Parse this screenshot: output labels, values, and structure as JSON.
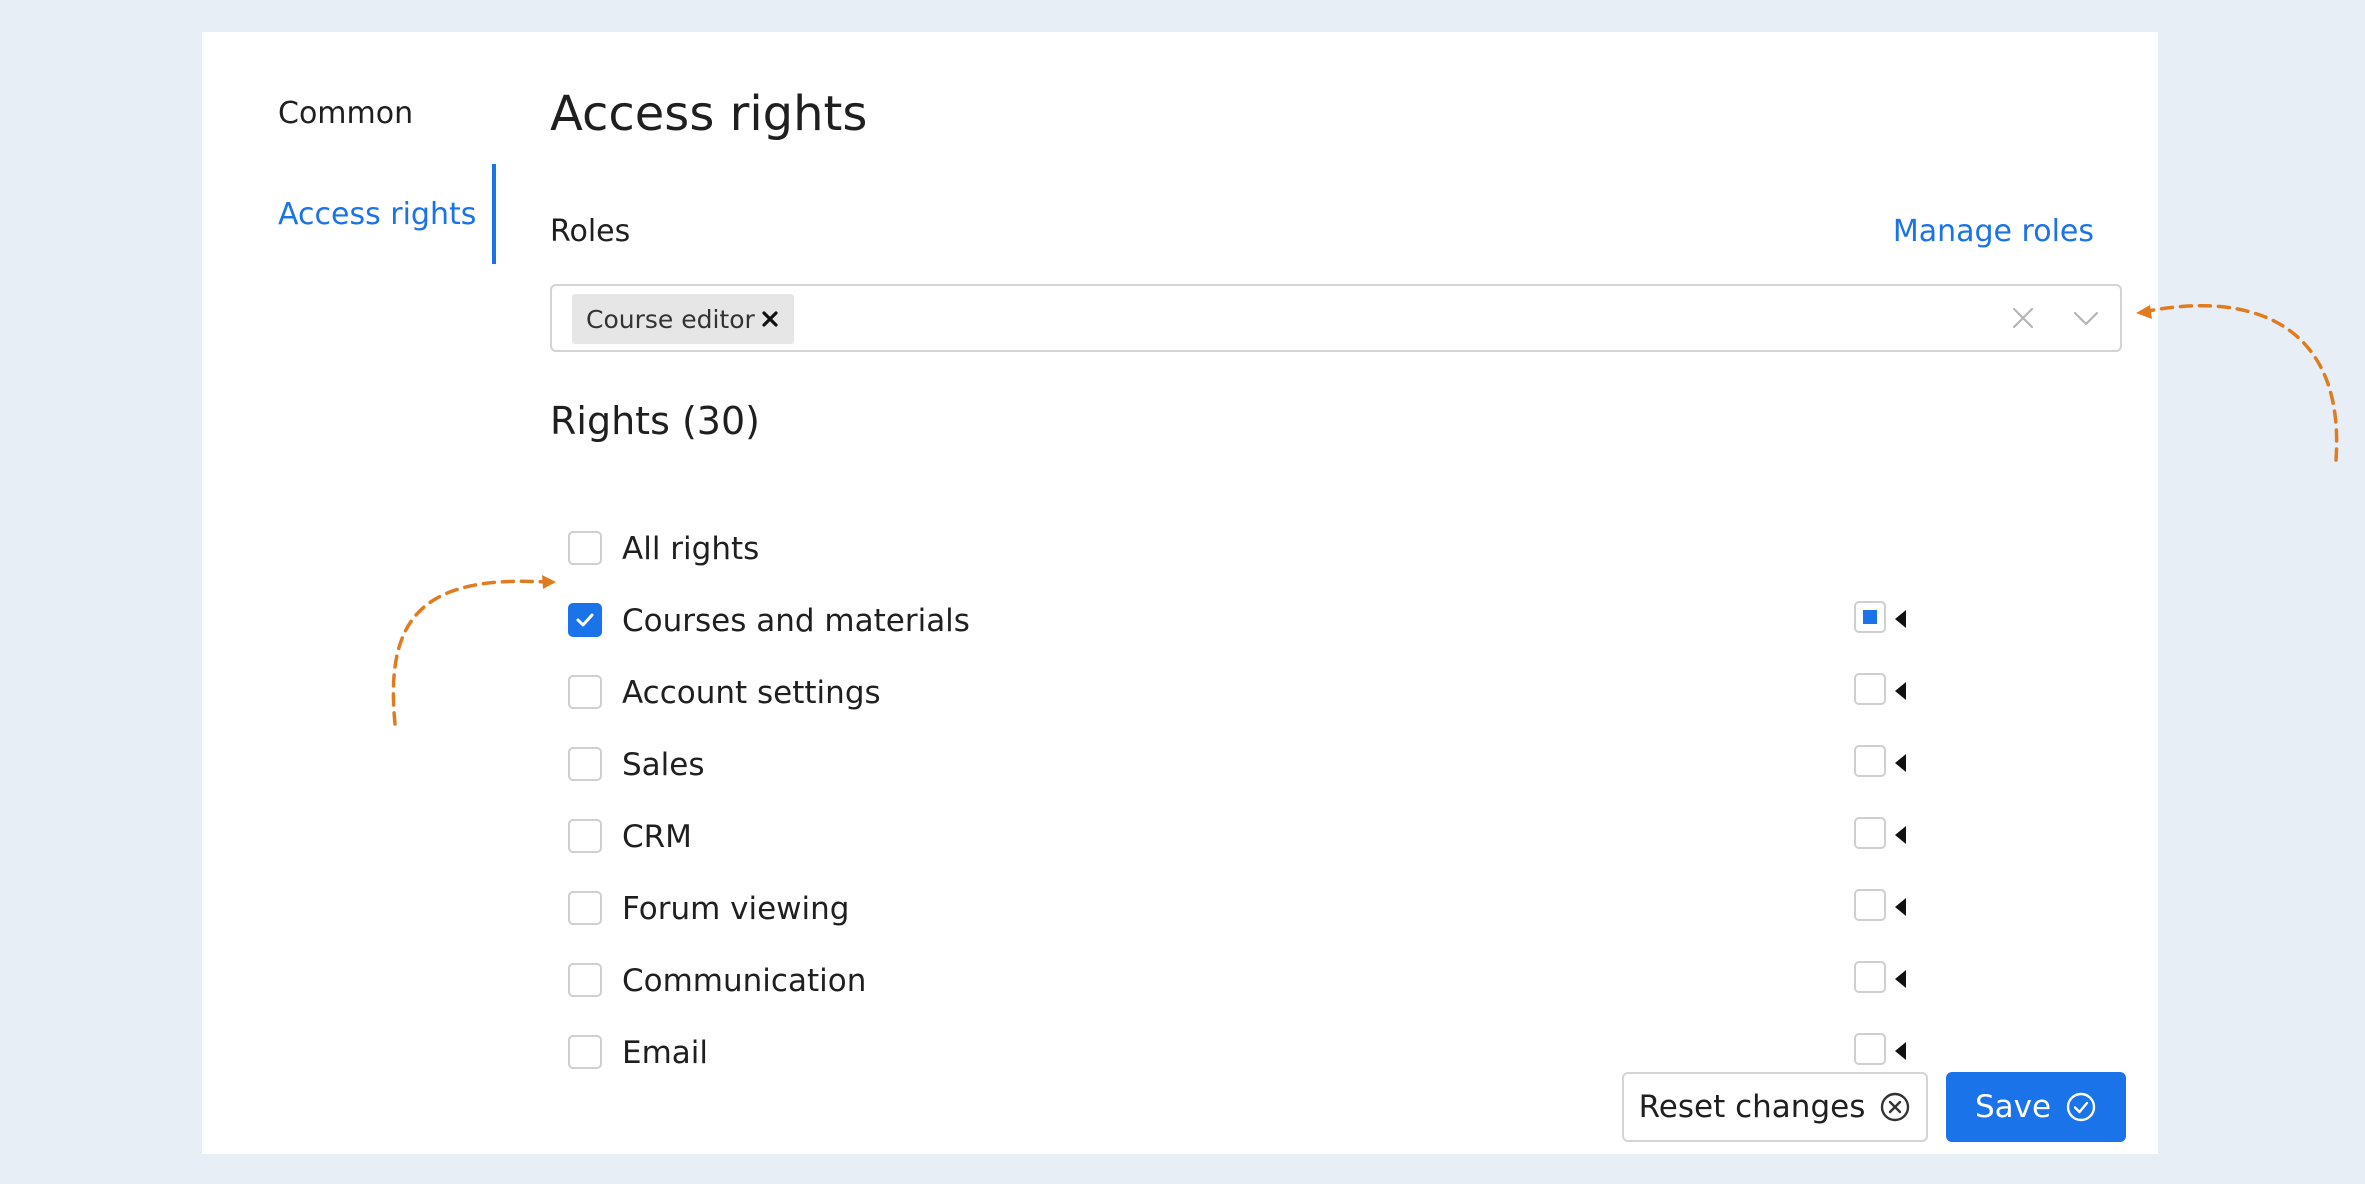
{
  "sidebar": {
    "items": [
      {
        "label": "Common",
        "active": false
      },
      {
        "label": "Access rights",
        "active": true
      }
    ]
  },
  "main": {
    "title": "Access rights",
    "roles": {
      "label": "Roles",
      "manage_link": "Manage roles",
      "selected": [
        {
          "label": "Course editor"
        }
      ]
    },
    "rights": {
      "title": "Rights (30)",
      "items": [
        {
          "label": "All rights",
          "checked": false,
          "has_subcontrol": false
        },
        {
          "label": "Courses and materials",
          "checked": true,
          "has_subcontrol": true,
          "sub_state": "partial"
        },
        {
          "label": "Account settings",
          "checked": false,
          "has_subcontrol": true,
          "sub_state": "empty"
        },
        {
          "label": "Sales",
          "checked": false,
          "has_subcontrol": true,
          "sub_state": "empty"
        },
        {
          "label": "CRM",
          "checked": false,
          "has_subcontrol": true,
          "sub_state": "empty"
        },
        {
          "label": "Forum viewing",
          "checked": false,
          "has_subcontrol": true,
          "sub_state": "empty"
        },
        {
          "label": "Communication",
          "checked": false,
          "has_subcontrol": true,
          "sub_state": "empty"
        },
        {
          "label": "Email",
          "checked": false,
          "has_subcontrol": true,
          "sub_state": "empty"
        }
      ]
    }
  },
  "actions": {
    "reset_label": "Reset changes",
    "save_label": "Save"
  },
  "colors": {
    "accent": "#1a73e8",
    "background": "#e8eef6",
    "annotation": "#e07b20"
  },
  "icons": {
    "tag_remove": "close-icon",
    "clear": "close-icon",
    "dropdown": "chevron-down-icon",
    "reset": "circle-x-icon",
    "save": "circle-check-icon",
    "expand": "caret-left-icon"
  }
}
